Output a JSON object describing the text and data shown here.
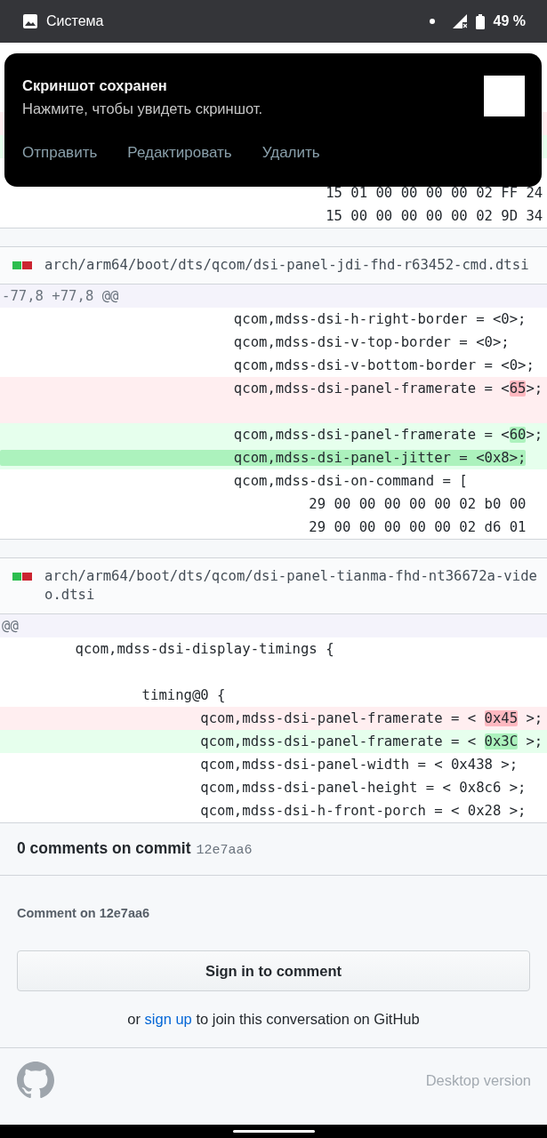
{
  "status_bar": {
    "app": "Система",
    "battery": "49 %"
  },
  "notification": {
    "title": "Скриншот сохранен",
    "message": "Нажмите, чтобы увидеть скриншот.",
    "actions": [
      "Отправить",
      "Редактировать",
      "Удалить"
    ]
  },
  "files": [
    {
      "rows": [
        {
          "kind": "context"
        },
        {
          "kind": "context"
        },
        {
          "kind": "context"
        },
        {
          "kind": "del"
        },
        {
          "kind": "add"
        },
        {
          "kind": "context"
        },
        {
          "kind": "context",
          "text": "                                       15 01 00 00 00 00 02 FF 24"
        },
        {
          "kind": "context",
          "text": "                                       15 00 00 00 00 00 02 9D 34"
        }
      ]
    },
    {
      "path": "arch/arm64/boot/dts/qcom/dsi-panel-jdi-fhd-r63452-cmd.dtsi",
      "hunk": "-77,8 +77,8 @@",
      "rows": [
        {
          "kind": "context",
          "text": "                            qcom,mdss-dsi-h-right-border = <0>;"
        },
        {
          "kind": "context",
          "text": "                            qcom,mdss-dsi-v-top-border = <0>;"
        },
        {
          "kind": "context",
          "text": "                            qcom,mdss-dsi-v-bottom-border = <0>;"
        },
        {
          "kind": "del",
          "segments": [
            {
              "text": "                            qcom,mdss-dsi-panel-framerate = <",
              "highlight": false
            },
            {
              "text": "65",
              "highlight": true
            },
            {
              "text": ">;",
              "highlight": false
            }
          ]
        },
        {
          "kind": "del"
        },
        {
          "kind": "add",
          "segments": [
            {
              "text": "                            qcom,mdss-dsi-panel-framerate = <",
              "highlight": false
            },
            {
              "text": "60",
              "highlight": true
            },
            {
              "text": ">;",
              "highlight": false
            }
          ]
        },
        {
          "kind": "add",
          "segments": [
            {
              "text": "                            qcom,mdss-dsi-panel-jitter = <0x8>;",
              "highlight": true
            }
          ]
        },
        {
          "kind": "context",
          "text": "                            qcom,mdss-dsi-on-command = ["
        },
        {
          "kind": "context",
          "text": "                                     29 00 00 00 00 00 02 b0 00"
        },
        {
          "kind": "context",
          "text": "                                     29 00 00 00 00 00 02 d6 01"
        }
      ]
    },
    {
      "path": "arch/arm64/boot/dts/qcom/dsi-panel-tianma-fhd-nt36672a-video.dtsi",
      "hunk": "@@",
      "rows": [
        {
          "kind": "context",
          "text": "         qcom,mdss-dsi-display-timings {"
        },
        {
          "kind": "context"
        },
        {
          "kind": "context",
          "text": "                 timing@0 {"
        },
        {
          "kind": "del",
          "segments": [
            {
              "text": "                        qcom,mdss-dsi-panel-framerate = < ",
              "highlight": false
            },
            {
              "text": "0x45",
              "highlight": true
            },
            {
              "text": " >;",
              "highlight": false
            }
          ]
        },
        {
          "kind": "add",
          "segments": [
            {
              "text": "                        qcom,mdss-dsi-panel-framerate = < ",
              "highlight": false
            },
            {
              "text": "0x3C",
              "highlight": true
            },
            {
              "text": " >;",
              "highlight": false
            }
          ]
        },
        {
          "kind": "context",
          "text": "                        qcom,mdss-dsi-panel-width = < 0x438 >;"
        },
        {
          "kind": "context",
          "text": "                        qcom,mdss-dsi-panel-height = < 0x8c6 >;"
        },
        {
          "kind": "context",
          "text": "                        qcom,mdss-dsi-h-front-porch = < 0x28 >;"
        }
      ]
    }
  ],
  "comments": {
    "title": "0 comments on commit",
    "sha": "12e7aa6",
    "form_label": "Comment on 12e7aa6",
    "button": "Sign in to comment",
    "signup": {
      "before": "or",
      "link": "sign up",
      "after": "to join this conversation on GitHub"
    }
  },
  "footer": {
    "link": "Desktop version"
  }
}
